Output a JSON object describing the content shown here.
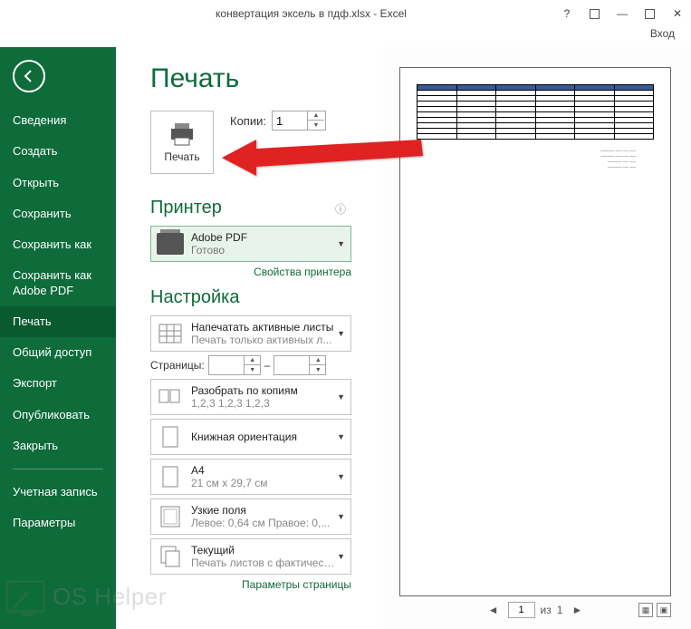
{
  "titlebar": {
    "title": "конвертация эксель в пдф.xlsx - Excel",
    "login": "Вход"
  },
  "sidebar": {
    "items": [
      "Сведения",
      "Создать",
      "Открыть",
      "Сохранить",
      "Сохранить как",
      "Сохранить как Adobe PDF",
      "Печать",
      "Общий доступ",
      "Экспорт",
      "Опубликовать",
      "Закрыть",
      "Учетная запись",
      "Параметры"
    ],
    "active_index": 6
  },
  "page": {
    "title": "Печать",
    "print_button": "Печать",
    "copies_label": "Копии:",
    "copies_value": "1"
  },
  "printer": {
    "section": "Принтер",
    "name": "Adobe PDF",
    "status": "Готово",
    "properties_link": "Свойства принтера"
  },
  "settings": {
    "section": "Настройка",
    "print_active": {
      "main": "Напечатать активные листы",
      "sub": "Печать только активных л..."
    },
    "pages_label": "Страницы:",
    "pages_sep": "–",
    "collate": {
      "main": "Разобрать по копиям",
      "sub": "1,2,3   1,2,3   1,2,3"
    },
    "orientation": {
      "main": "Книжная ориентация",
      "sub": ""
    },
    "paper": {
      "main": "A4",
      "sub": "21 см x 29,7 см"
    },
    "margins": {
      "main": "Узкие поля",
      "sub": "Левое:  0,64 см   Правое:  0,..."
    },
    "scaling": {
      "main": "Текущий",
      "sub": "Печать листов с фактическ..."
    },
    "page_setup_link": "Параметры страницы"
  },
  "preview": {
    "page_current": "1",
    "page_sep": "из",
    "page_total": "1"
  },
  "watermark": {
    "text": "OS Helper"
  }
}
